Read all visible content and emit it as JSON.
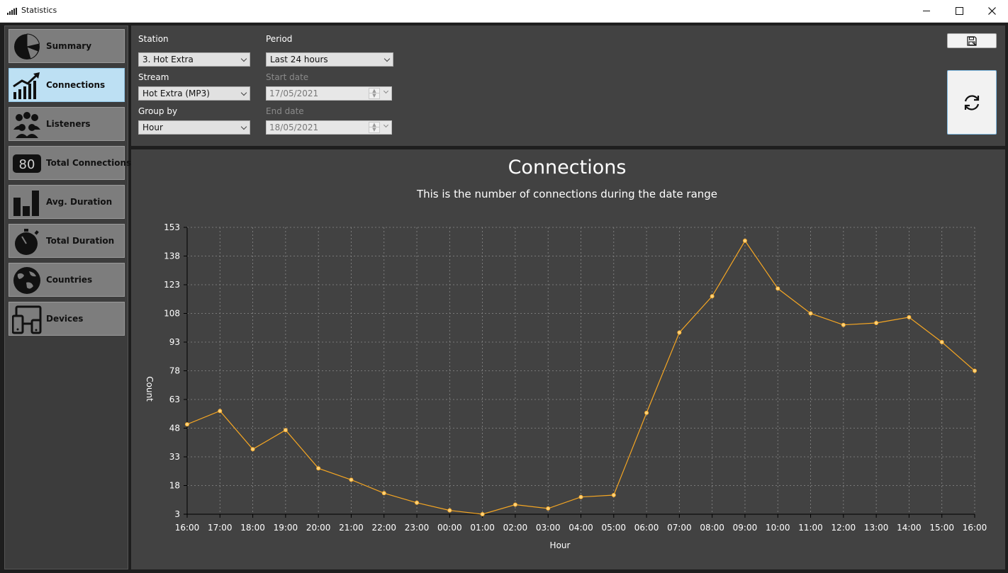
{
  "window": {
    "title": "Statistics",
    "controls": [
      "minimize",
      "maximize",
      "close"
    ]
  },
  "sidebar": {
    "items": [
      {
        "label": "Summary",
        "icon": "pie-chart-icon",
        "active": false
      },
      {
        "label": "Connections",
        "icon": "trending-up-icon",
        "active": true
      },
      {
        "label": "Listeners",
        "icon": "people-icon",
        "active": false
      },
      {
        "label": "Total Connections",
        "icon": "counter-icon",
        "icon_text": "80",
        "active": false
      },
      {
        "label": "Avg. Duration",
        "icon": "bar-chart-icon",
        "active": false
      },
      {
        "label": "Total Duration",
        "icon": "stopwatch-icon",
        "active": false
      },
      {
        "label": "Countries",
        "icon": "globe-icon",
        "active": false
      },
      {
        "label": "Devices",
        "icon": "devices-icon",
        "active": false
      }
    ]
  },
  "filters": {
    "station": {
      "label": "Station",
      "value": "3. Hot Extra"
    },
    "stream": {
      "label": "Stream",
      "value": "Hot Extra (MP3)"
    },
    "group_by": {
      "label": "Group by",
      "value": "Hour"
    },
    "period": {
      "label": "Period",
      "value": "Last 24 hours"
    },
    "start_date": {
      "label": "Start date",
      "value": "17/05/2021",
      "disabled": true
    },
    "end_date": {
      "label": "End date",
      "value": "18/05/2021",
      "disabled": true
    }
  },
  "buttons": {
    "save": {
      "icon": "save-icon"
    },
    "refresh": {
      "icon": "refresh-icon"
    }
  },
  "colors": {
    "accent": "#bde0f3",
    "line": "#f5a623",
    "panel": "#424242"
  },
  "chart_data": {
    "type": "line",
    "title": "Connections",
    "subtitle": "This is the number of connections during the date range",
    "xlabel": "Hour",
    "ylabel": "Count",
    "x": [
      "16:00",
      "17:00",
      "18:00",
      "19:00",
      "20:00",
      "21:00",
      "22:00",
      "23:00",
      "00:00",
      "01:00",
      "02:00",
      "03:00",
      "04:00",
      "05:00",
      "06:00",
      "07:00",
      "08:00",
      "09:00",
      "10:00",
      "11:00",
      "12:00",
      "13:00",
      "14:00",
      "15:00",
      "16:00"
    ],
    "values": [
      50,
      57,
      37,
      47,
      27,
      21,
      14,
      9,
      5,
      3,
      8,
      6,
      12,
      13,
      56,
      98,
      117,
      146,
      121,
      108,
      102,
      103,
      106,
      93,
      78
    ],
    "yticks": [
      3,
      18,
      33,
      48,
      63,
      78,
      93,
      108,
      123,
      138,
      153
    ],
    "ylim": [
      3,
      153
    ],
    "grid": true
  }
}
